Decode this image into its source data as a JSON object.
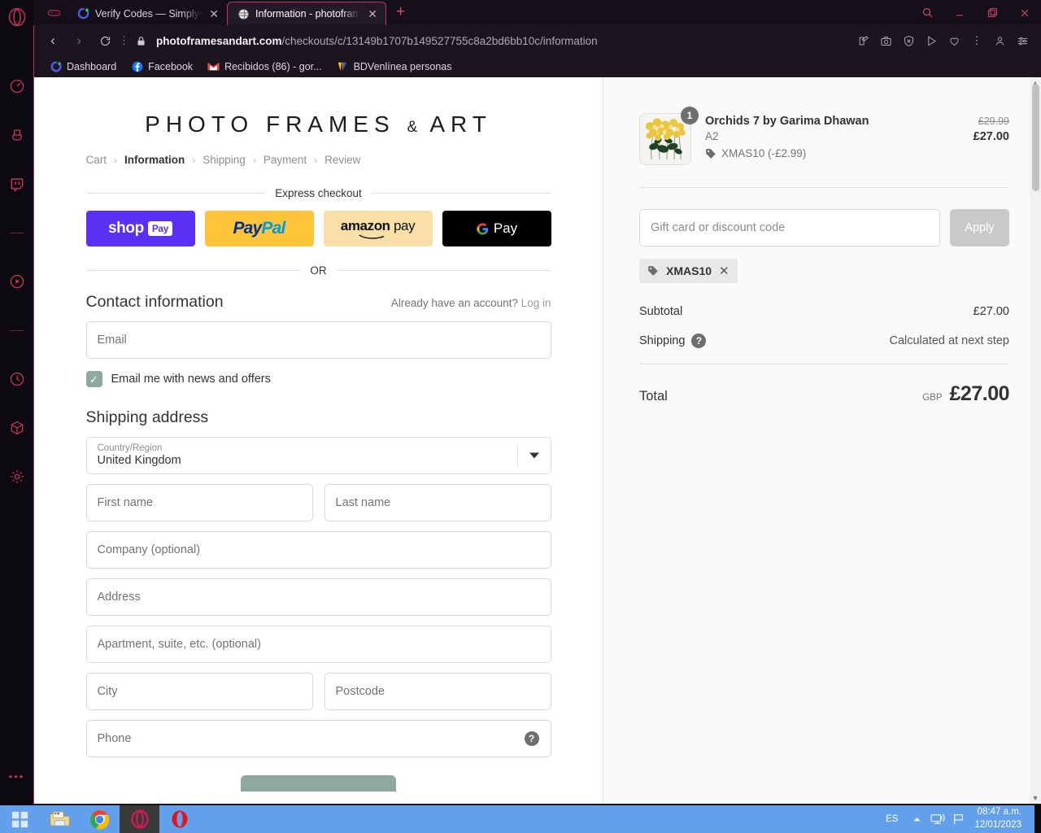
{
  "browser": {
    "tabs": [
      {
        "title": "Verify Codes — SimplyCodes",
        "favicon": "simplycodes-icon",
        "active": false
      },
      {
        "title": "Information - photoframesa",
        "favicon": "globe-icon",
        "active": true
      }
    ],
    "new_tab_label": "+",
    "window_controls": {
      "search": "search-icon",
      "minimize": "minimize-icon",
      "restore": "restore-icon",
      "close": "close-icon"
    },
    "address": {
      "domain": "photoframesandart.com",
      "path": "/checkouts/c/13149b1707b149527755c8a2bd6bb10c/information",
      "lock": "lock-icon",
      "back": "back-arrow",
      "forward": "forward-arrow",
      "reload": "reload-icon"
    },
    "bookmarks": [
      {
        "label": "Dashboard",
        "icon": "simplycodes-icon"
      },
      {
        "label": "Facebook",
        "icon": "facebook-icon"
      },
      {
        "label": "Recibidos (86) - gor...",
        "icon": "gmail-icon"
      },
      {
        "label": "BDVenlínea personas",
        "icon": "bdv-icon"
      }
    ],
    "sidebar_icons": [
      "speedometer-icon",
      "brush-icon",
      "twitch-icon",
      "divider",
      "player-icon",
      "divider",
      "history-icon",
      "cube-icon",
      "settings-icon"
    ],
    "sidebar_more": "•••"
  },
  "checkout": {
    "brand": "PHOTO FRAMES & ART",
    "brand_parts": {
      "pre": "PHOTO FRAMES",
      "amp": "&",
      "post": "ART"
    },
    "breadcrumb": [
      {
        "label": "Cart",
        "current": false
      },
      {
        "label": "Information",
        "current": true
      },
      {
        "label": "Shipping",
        "current": false
      },
      {
        "label": "Payment",
        "current": false
      },
      {
        "label": "Review",
        "current": false
      }
    ],
    "breadcrumb_sep": "›",
    "express_label": "Express checkout",
    "express_buttons": [
      {
        "name": "shop-pay",
        "text": "shop",
        "badge": "Pay",
        "bg": "#5a31f4"
      },
      {
        "name": "paypal",
        "text_a": "Pay",
        "text_b": "Pal",
        "bg": "#ffc439"
      },
      {
        "name": "amazon-pay",
        "text_a": "amazon",
        "text_b": " pay",
        "bg": "#f7dfa5"
      },
      {
        "name": "google-pay",
        "text": "Pay",
        "bg": "#000000"
      }
    ],
    "or_label": "OR",
    "contact": {
      "title": "Contact information",
      "account_prompt": "Already have an account?",
      "login_label": "Log in",
      "email_placeholder": "Email",
      "newsletter_label": "Email me with news and offers",
      "newsletter_checked": true,
      "checkbox_color": "#8fa8a0"
    },
    "shipping": {
      "title": "Shipping address",
      "country_label": "Country/Region",
      "country_value": "United Kingdom",
      "first_name_placeholder": "First name",
      "last_name_placeholder": "Last name",
      "company_placeholder": "Company (optional)",
      "address_placeholder": "Address",
      "apartment_placeholder": "Apartment, suite, etc. (optional)",
      "city_placeholder": "City",
      "postcode_placeholder": "Postcode",
      "phone_placeholder": "Phone",
      "phone_help_icon": "question-mark-icon"
    }
  },
  "summary": {
    "item": {
      "title": "Orchids 7 by Garima Dhawan",
      "variant": "A2",
      "discount": "XMAS10 (-£2.99)",
      "discount_icon": "tag-icon",
      "quantity": "1",
      "price_original": "£29.99",
      "price_final": "£27.00",
      "thumbnail": "orchids-artwork"
    },
    "discount_input_placeholder": "Gift card or discount code",
    "apply_label": "Apply",
    "applied_code": "XMAS10",
    "applied_code_remove": "✕",
    "subtotal_label": "Subtotal",
    "subtotal_value": "£27.00",
    "shipping_label": "Shipping",
    "shipping_help_icon": "question-mark-icon",
    "shipping_value": "Calculated at next step",
    "total_label": "Total",
    "currency": "GBP",
    "total_value": "£27.00"
  },
  "taskbar": {
    "start": "windows-start-icon",
    "apps": [
      "file-explorer-icon",
      "chrome-icon",
      "opera-gx-icon",
      "opera-icon"
    ],
    "language": "ES",
    "tray": [
      "show-hidden-icon",
      "network-icon",
      "flag-icon"
    ],
    "time": "08:47 a.m.",
    "date": "12/01/2023"
  }
}
